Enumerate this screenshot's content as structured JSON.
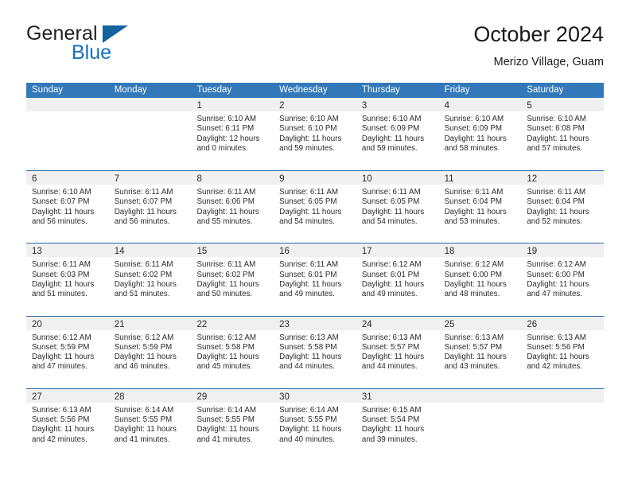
{
  "brand": {
    "word1": "General",
    "word2": "Blue",
    "triangle_color": "#14639e",
    "blue_text_color": "#1271bb"
  },
  "header": {
    "title": "October 2024",
    "subtitle": "Merizo Village, Guam"
  },
  "theme": {
    "header_bg": "#3379ba",
    "header_text": "#ffffff",
    "row_divider": "#2a6aa8",
    "number_band_bg": "#f0f0f0",
    "body_text": "#2b2b2b"
  },
  "weekdays": [
    "Sunday",
    "Monday",
    "Tuesday",
    "Wednesday",
    "Thursday",
    "Friday",
    "Saturday"
  ],
  "labels": {
    "sunrise_prefix": "Sunrise:",
    "sunset_prefix": "Sunset:",
    "daylight_prefix": "Daylight:"
  },
  "weeks": [
    [
      {
        "day": "",
        "empty": true
      },
      {
        "day": "",
        "empty": true
      },
      {
        "day": "1",
        "sunrise": "Sunrise: 6:10 AM",
        "sunset": "Sunset: 6:11 PM",
        "daylight1": "Daylight: 12 hours",
        "daylight2": "and 0 minutes."
      },
      {
        "day": "2",
        "sunrise": "Sunrise: 6:10 AM",
        "sunset": "Sunset: 6:10 PM",
        "daylight1": "Daylight: 11 hours",
        "daylight2": "and 59 minutes."
      },
      {
        "day": "3",
        "sunrise": "Sunrise: 6:10 AM",
        "sunset": "Sunset: 6:09 PM",
        "daylight1": "Daylight: 11 hours",
        "daylight2": "and 59 minutes."
      },
      {
        "day": "4",
        "sunrise": "Sunrise: 6:10 AM",
        "sunset": "Sunset: 6:09 PM",
        "daylight1": "Daylight: 11 hours",
        "daylight2": "and 58 minutes."
      },
      {
        "day": "5",
        "sunrise": "Sunrise: 6:10 AM",
        "sunset": "Sunset: 6:08 PM",
        "daylight1": "Daylight: 11 hours",
        "daylight2": "and 57 minutes."
      }
    ],
    [
      {
        "day": "6",
        "sunrise": "Sunrise: 6:10 AM",
        "sunset": "Sunset: 6:07 PM",
        "daylight1": "Daylight: 11 hours",
        "daylight2": "and 56 minutes."
      },
      {
        "day": "7",
        "sunrise": "Sunrise: 6:11 AM",
        "sunset": "Sunset: 6:07 PM",
        "daylight1": "Daylight: 11 hours",
        "daylight2": "and 56 minutes."
      },
      {
        "day": "8",
        "sunrise": "Sunrise: 6:11 AM",
        "sunset": "Sunset: 6:06 PM",
        "daylight1": "Daylight: 11 hours",
        "daylight2": "and 55 minutes."
      },
      {
        "day": "9",
        "sunrise": "Sunrise: 6:11 AM",
        "sunset": "Sunset: 6:05 PM",
        "daylight1": "Daylight: 11 hours",
        "daylight2": "and 54 minutes."
      },
      {
        "day": "10",
        "sunrise": "Sunrise: 6:11 AM",
        "sunset": "Sunset: 6:05 PM",
        "daylight1": "Daylight: 11 hours",
        "daylight2": "and 54 minutes."
      },
      {
        "day": "11",
        "sunrise": "Sunrise: 6:11 AM",
        "sunset": "Sunset: 6:04 PM",
        "daylight1": "Daylight: 11 hours",
        "daylight2": "and 53 minutes."
      },
      {
        "day": "12",
        "sunrise": "Sunrise: 6:11 AM",
        "sunset": "Sunset: 6:04 PM",
        "daylight1": "Daylight: 11 hours",
        "daylight2": "and 52 minutes."
      }
    ],
    [
      {
        "day": "13",
        "sunrise": "Sunrise: 6:11 AM",
        "sunset": "Sunset: 6:03 PM",
        "daylight1": "Daylight: 11 hours",
        "daylight2": "and 51 minutes."
      },
      {
        "day": "14",
        "sunrise": "Sunrise: 6:11 AM",
        "sunset": "Sunset: 6:02 PM",
        "daylight1": "Daylight: 11 hours",
        "daylight2": "and 51 minutes."
      },
      {
        "day": "15",
        "sunrise": "Sunrise: 6:11 AM",
        "sunset": "Sunset: 6:02 PM",
        "daylight1": "Daylight: 11 hours",
        "daylight2": "and 50 minutes."
      },
      {
        "day": "16",
        "sunrise": "Sunrise: 6:11 AM",
        "sunset": "Sunset: 6:01 PM",
        "daylight1": "Daylight: 11 hours",
        "daylight2": "and 49 minutes."
      },
      {
        "day": "17",
        "sunrise": "Sunrise: 6:12 AM",
        "sunset": "Sunset: 6:01 PM",
        "daylight1": "Daylight: 11 hours",
        "daylight2": "and 49 minutes."
      },
      {
        "day": "18",
        "sunrise": "Sunrise: 6:12 AM",
        "sunset": "Sunset: 6:00 PM",
        "daylight1": "Daylight: 11 hours",
        "daylight2": "and 48 minutes."
      },
      {
        "day": "19",
        "sunrise": "Sunrise: 6:12 AM",
        "sunset": "Sunset: 6:00 PM",
        "daylight1": "Daylight: 11 hours",
        "daylight2": "and 47 minutes."
      }
    ],
    [
      {
        "day": "20",
        "sunrise": "Sunrise: 6:12 AM",
        "sunset": "Sunset: 5:59 PM",
        "daylight1": "Daylight: 11 hours",
        "daylight2": "and 47 minutes."
      },
      {
        "day": "21",
        "sunrise": "Sunrise: 6:12 AM",
        "sunset": "Sunset: 5:59 PM",
        "daylight1": "Daylight: 11 hours",
        "daylight2": "and 46 minutes."
      },
      {
        "day": "22",
        "sunrise": "Sunrise: 6:12 AM",
        "sunset": "Sunset: 5:58 PM",
        "daylight1": "Daylight: 11 hours",
        "daylight2": "and 45 minutes."
      },
      {
        "day": "23",
        "sunrise": "Sunrise: 6:13 AM",
        "sunset": "Sunset: 5:58 PM",
        "daylight1": "Daylight: 11 hours",
        "daylight2": "and 44 minutes."
      },
      {
        "day": "24",
        "sunrise": "Sunrise: 6:13 AM",
        "sunset": "Sunset: 5:57 PM",
        "daylight1": "Daylight: 11 hours",
        "daylight2": "and 44 minutes."
      },
      {
        "day": "25",
        "sunrise": "Sunrise: 6:13 AM",
        "sunset": "Sunset: 5:57 PM",
        "daylight1": "Daylight: 11 hours",
        "daylight2": "and 43 minutes."
      },
      {
        "day": "26",
        "sunrise": "Sunrise: 6:13 AM",
        "sunset": "Sunset: 5:56 PM",
        "daylight1": "Daylight: 11 hours",
        "daylight2": "and 42 minutes."
      }
    ],
    [
      {
        "day": "27",
        "sunrise": "Sunrise: 6:13 AM",
        "sunset": "Sunset: 5:56 PM",
        "daylight1": "Daylight: 11 hours",
        "daylight2": "and 42 minutes."
      },
      {
        "day": "28",
        "sunrise": "Sunrise: 6:14 AM",
        "sunset": "Sunset: 5:55 PM",
        "daylight1": "Daylight: 11 hours",
        "daylight2": "and 41 minutes."
      },
      {
        "day": "29",
        "sunrise": "Sunrise: 6:14 AM",
        "sunset": "Sunset: 5:55 PM",
        "daylight1": "Daylight: 11 hours",
        "daylight2": "and 41 minutes."
      },
      {
        "day": "30",
        "sunrise": "Sunrise: 6:14 AM",
        "sunset": "Sunset: 5:55 PM",
        "daylight1": "Daylight: 11 hours",
        "daylight2": "and 40 minutes."
      },
      {
        "day": "31",
        "sunrise": "Sunrise: 6:15 AM",
        "sunset": "Sunset: 5:54 PM",
        "daylight1": "Daylight: 11 hours",
        "daylight2": "and 39 minutes."
      },
      {
        "day": "",
        "empty": true
      },
      {
        "day": "",
        "empty": true
      }
    ]
  ]
}
